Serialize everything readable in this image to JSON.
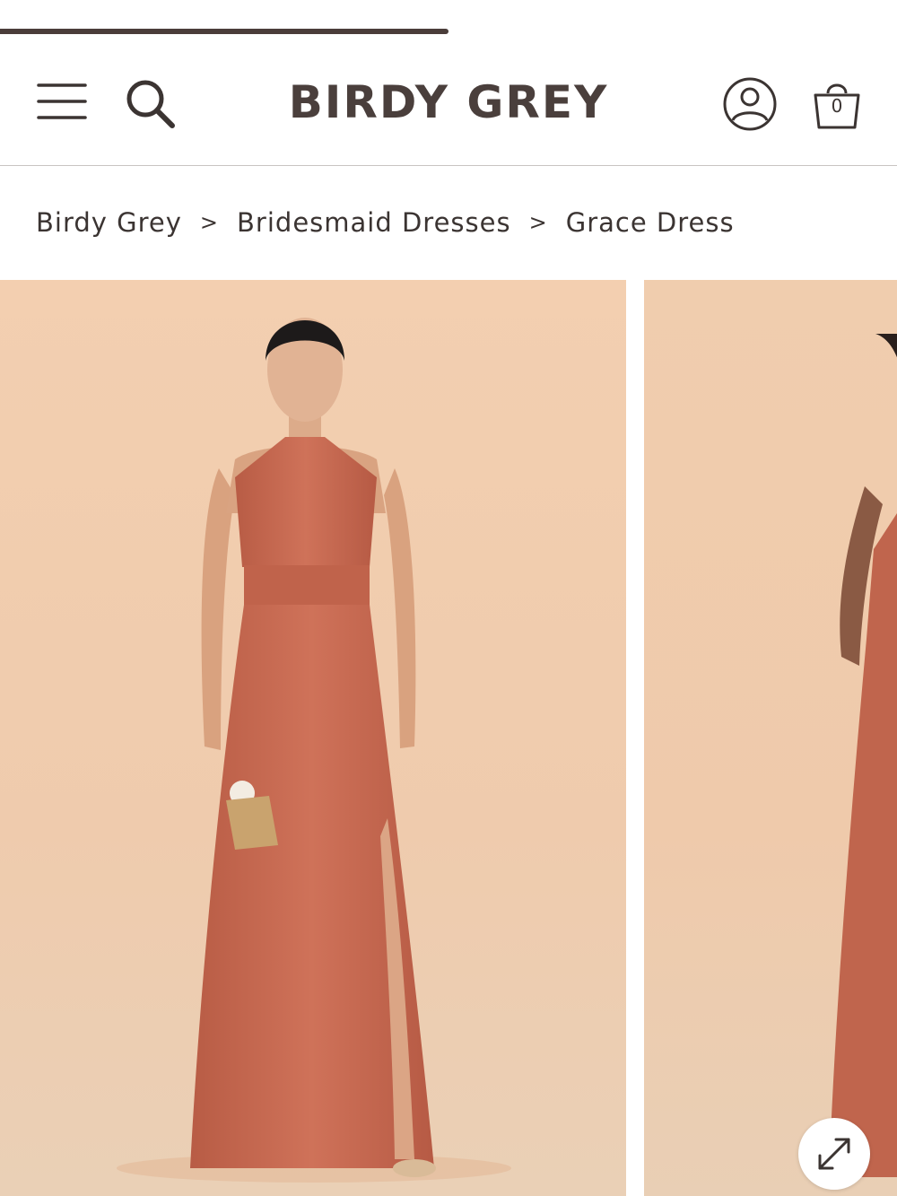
{
  "progress": {
    "fraction": 0.5
  },
  "header": {
    "logo": "BIRDY GREY",
    "menu_icon": "hamburger-menu-icon",
    "search_icon": "search-icon",
    "account_icon": "user-account-icon",
    "bag_icon": "shopping-bag-icon",
    "bag_count": "0"
  },
  "breadcrumb": {
    "items": [
      "Birdy Grey",
      "Bridesmaid Dresses",
      "Grace Dress"
    ],
    "separator": ">"
  },
  "gallery": {
    "expand_icon": "expand-arrows-icon"
  },
  "colors": {
    "dress": "#c46a52",
    "backdrop": "#f1cdae",
    "text": "#3b3432"
  }
}
